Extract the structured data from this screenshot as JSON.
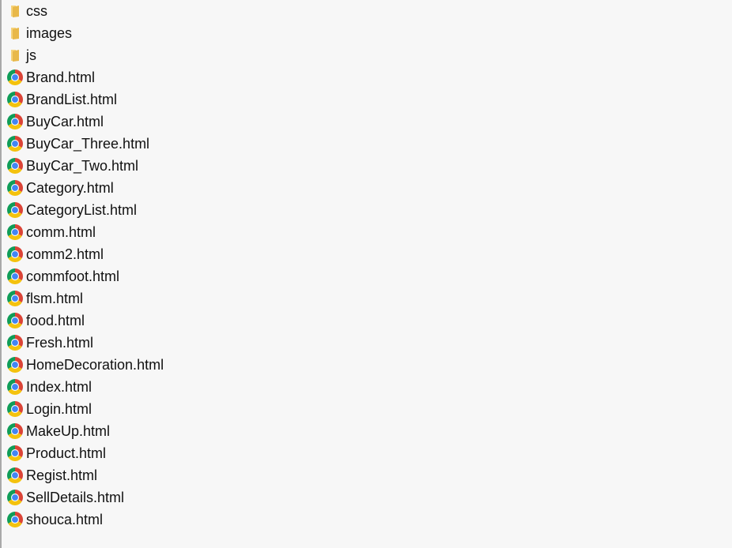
{
  "colors": {
    "folder_yellow": "#e8b84a",
    "folder_light": "#f5d27a",
    "chrome_red": "#db4437",
    "chrome_yellow": "#f4c20d",
    "chrome_green": "#0f9d58",
    "chrome_blue": "#4285f4",
    "background": "#f7f7f7",
    "text": "#111111"
  },
  "files": [
    {
      "name": "css",
      "type": "folder",
      "icon": "folder-icon"
    },
    {
      "name": "images",
      "type": "folder",
      "icon": "folder-icon"
    },
    {
      "name": "js",
      "type": "folder",
      "icon": "folder-icon"
    },
    {
      "name": "Brand.html",
      "type": "html",
      "icon": "chrome-icon"
    },
    {
      "name": "BrandList.html",
      "type": "html",
      "icon": "chrome-icon"
    },
    {
      "name": "BuyCar.html",
      "type": "html",
      "icon": "chrome-icon"
    },
    {
      "name": "BuyCar_Three.html",
      "type": "html",
      "icon": "chrome-icon"
    },
    {
      "name": "BuyCar_Two.html",
      "type": "html",
      "icon": "chrome-icon"
    },
    {
      "name": "Category.html",
      "type": "html",
      "icon": "chrome-icon"
    },
    {
      "name": "CategoryList.html",
      "type": "html",
      "icon": "chrome-icon"
    },
    {
      "name": "comm.html",
      "type": "html",
      "icon": "chrome-icon"
    },
    {
      "name": "comm2.html",
      "type": "html",
      "icon": "chrome-icon"
    },
    {
      "name": "commfoot.html",
      "type": "html",
      "icon": "chrome-icon"
    },
    {
      "name": "flsm.html",
      "type": "html",
      "icon": "chrome-icon"
    },
    {
      "name": "food.html",
      "type": "html",
      "icon": "chrome-icon"
    },
    {
      "name": "Fresh.html",
      "type": "html",
      "icon": "chrome-icon"
    },
    {
      "name": "HomeDecoration.html",
      "type": "html",
      "icon": "chrome-icon"
    },
    {
      "name": "Index.html",
      "type": "html",
      "icon": "chrome-icon"
    },
    {
      "name": "Login.html",
      "type": "html",
      "icon": "chrome-icon"
    },
    {
      "name": "MakeUp.html",
      "type": "html",
      "icon": "chrome-icon"
    },
    {
      "name": "Product.html",
      "type": "html",
      "icon": "chrome-icon"
    },
    {
      "name": "Regist.html",
      "type": "html",
      "icon": "chrome-icon"
    },
    {
      "name": "SellDetails.html",
      "type": "html",
      "icon": "chrome-icon"
    },
    {
      "name": "shouca.html",
      "type": "html",
      "icon": "chrome-icon"
    }
  ]
}
